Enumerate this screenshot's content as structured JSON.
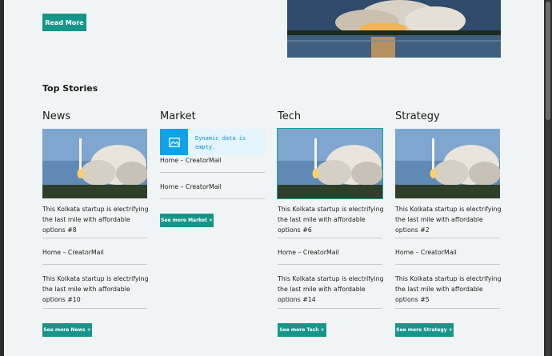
{
  "header": {
    "read_more_label": "Read More"
  },
  "section": {
    "title": "Top Stories"
  },
  "columns": [
    {
      "title": "News",
      "items": [
        "This Kolkata startup is electrifying the last mile with affordable options #8",
        "Home – CreatorMail",
        "This Kolkata startup is electrifying the last mile with affordable options #10"
      ],
      "more_label": "See more News +"
    },
    {
      "title": "Market",
      "dynamic_notice": "Dynamic data is empty.",
      "items": [
        "Home – CreatorMail",
        "Home – CreatorMail"
      ],
      "more_label": "See more Market +"
    },
    {
      "title": "Tech",
      "items": [
        "This Kolkata startup is electrifying the last mile with affordable options #6",
        "Home – CreatorMail",
        "This Kolkata startup is electrifying the last mile with affordable options #14"
      ],
      "more_label": "See more Tech +"
    },
    {
      "title": "Strategy",
      "items": [
        "This Kolkata startup is electrifying the last mile with affordable options #2",
        "Home – CreatorMail",
        "This Kolkata startup is electrifying the last mile with affordable options #5"
      ],
      "more_label": "See more Strategy +"
    }
  ],
  "colors": {
    "accent": "#16968a",
    "info_bg": "#e3f4fd",
    "info_icon": "#0fa2e8"
  },
  "icons": [
    "rocket-launch-image",
    "image-placeholder-icon"
  ]
}
